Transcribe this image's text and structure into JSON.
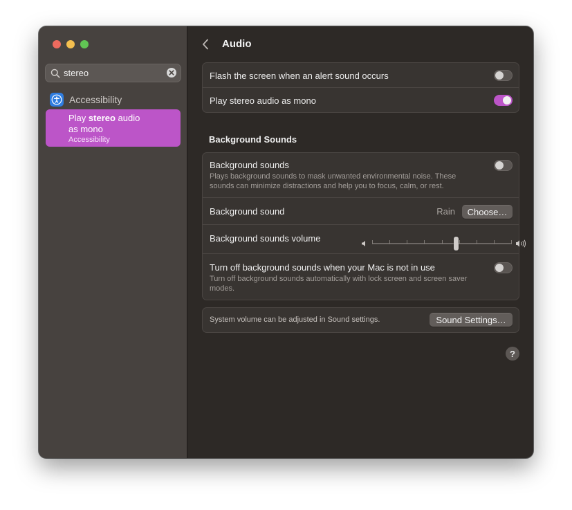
{
  "window": {
    "traffic_lights": [
      "close",
      "minimize",
      "zoom"
    ]
  },
  "sidebar": {
    "search": {
      "value": "stereo",
      "icon": "search-icon",
      "clear_icon": "clear-icon"
    },
    "category": {
      "label": "Accessibility",
      "icon": "accessibility-icon",
      "icon_color": "#2f7de0"
    },
    "result": {
      "prefix": "Play ",
      "highlight": "stereo",
      "suffix": " audio",
      "line2": "as mono",
      "subtitle": "Accessibility",
      "highlight_color": "#bc55c8"
    }
  },
  "header": {
    "title": "Audio",
    "back_icon": "chevron-left-icon"
  },
  "alerts": {
    "flash_label": "Flash the screen when an alert sound occurs",
    "flash_on": false,
    "mono_label": "Play stereo audio as mono",
    "mono_on": true
  },
  "background_sounds": {
    "section_title": "Background Sounds",
    "toggle_label": "Background sounds",
    "toggle_desc": "Plays background sounds to mask unwanted environmental noise. These sounds can minimize distractions and help you to focus, calm, or rest.",
    "toggle_on": false,
    "sound_label": "Background sound",
    "sound_value": "Rain",
    "choose_button": "Choose…",
    "volume_label": "Background sounds volume",
    "volume_level": 0.6,
    "volume_low_icon": "speaker-low-icon",
    "volume_high_icon": "speaker-high-icon",
    "idle_label": "Turn off background sounds when your Mac is not in use",
    "idle_desc": "Turn off background sounds automatically with lock screen and screen saver modes.",
    "idle_on": false
  },
  "footer": {
    "note": "System volume can be adjusted in Sound settings.",
    "button": "Sound Settings…"
  },
  "help": {
    "label": "?",
    "icon": "help-icon"
  },
  "colors": {
    "accent": "#bc55c8",
    "sidebar_bg": "#47423f",
    "content_bg": "#2d2926",
    "group_bg": "#383431"
  }
}
